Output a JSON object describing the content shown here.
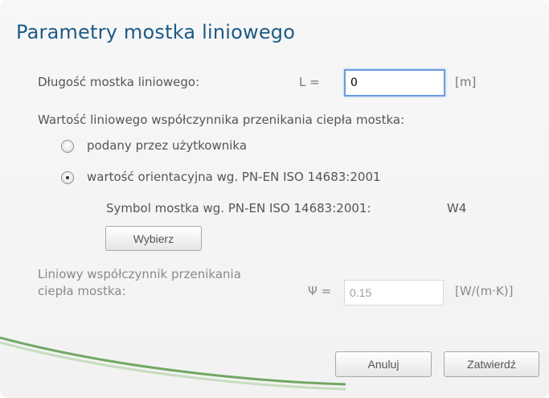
{
  "dialog": {
    "title": "Parametry mostka liniowego",
    "length_label": "Długość mostka liniowego:",
    "length_symbol": "L =",
    "length_value": "0",
    "length_unit": "[m]",
    "coef_section_label": "Wartość liniowego współczynnika przenikania ciepła mostka:",
    "radio_user": {
      "label": "podany przez użytkownika",
      "selected": false
    },
    "radio_orient": {
      "label": "wartość orientacyjna wg. PN-EN ISO 14683:2001",
      "selected": true
    },
    "symbol_label": "Symbol mostka wg. PN-EN ISO 14683:2001:",
    "symbol_value": "W4",
    "choose_button": "Wybierz",
    "psi_label_line1": "Liniowy współczynnik przenikania",
    "psi_label_line2": "ciepła mostka:",
    "psi_symbol": "Ψ =",
    "psi_value": "0.15",
    "psi_unit": "[W/(m·K)]",
    "cancel_button": "Anuluj",
    "confirm_button": "Zatwierdź"
  },
  "colors": {
    "title": "#1d5b86",
    "accent_swoosh": "#5a9a4a",
    "focus_border": "#6a9be0"
  }
}
